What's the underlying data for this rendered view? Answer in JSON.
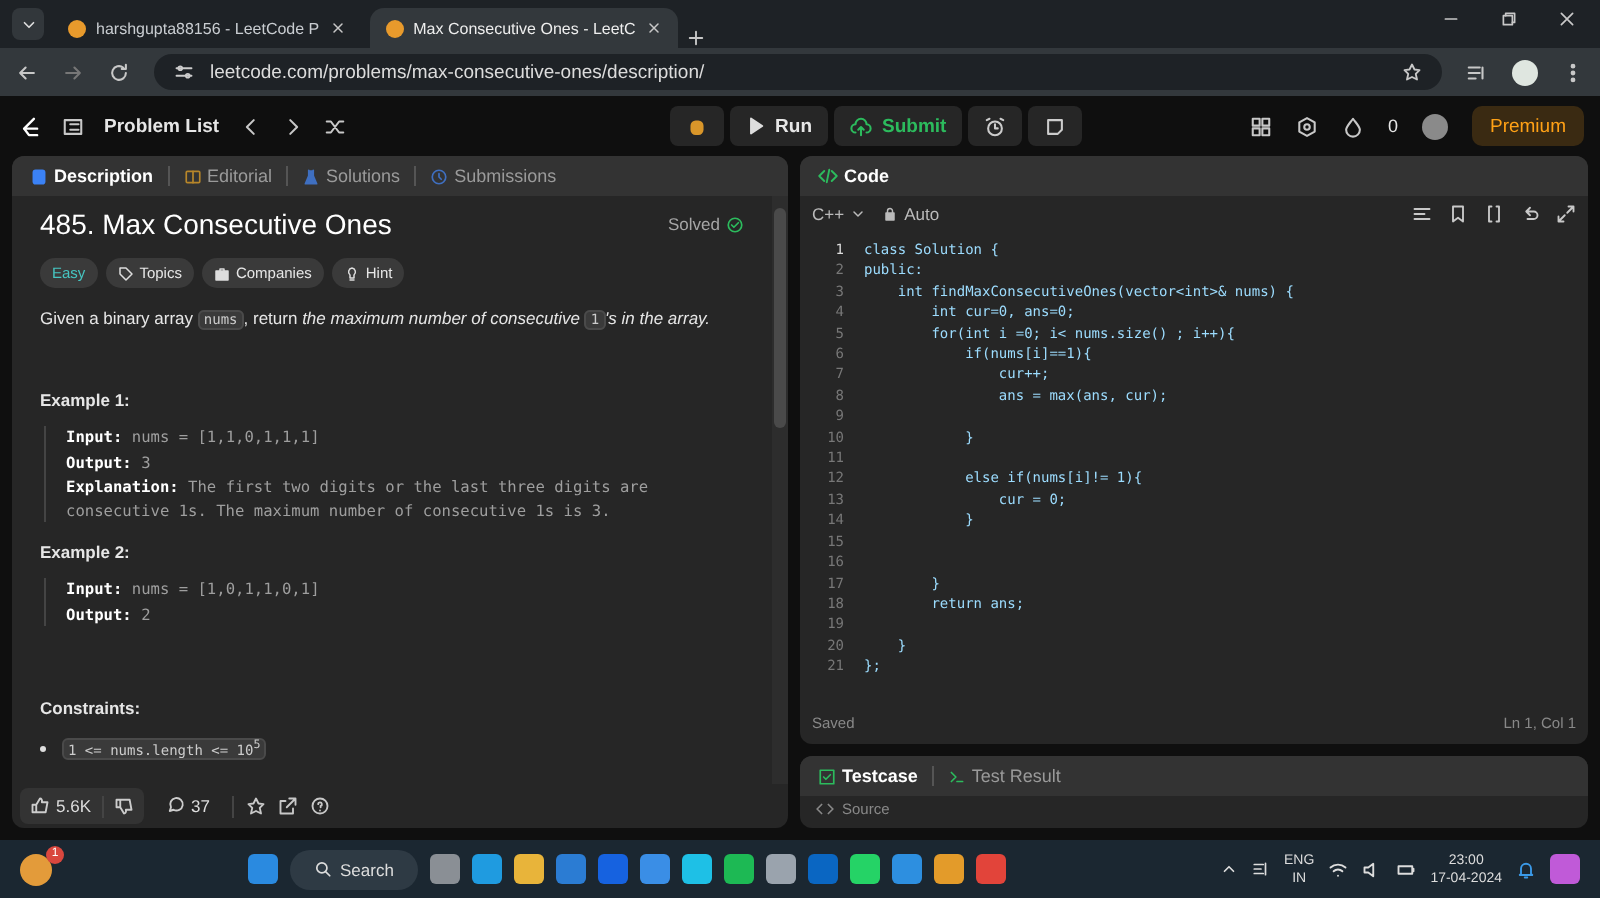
{
  "browser": {
    "tabs": [
      {
        "title": "harshgupta88156 - LeetCode P",
        "selected": false
      },
      {
        "title": "Max Consecutive Ones - LeetC",
        "selected": true
      }
    ],
    "url": "leetcode.com/problems/max-consecutive-ones/description/"
  },
  "navbar": {
    "problem_list": "Problem List",
    "run": "Run",
    "submit": "Submit",
    "streak": "0",
    "premium": "Premium"
  },
  "description_panel": {
    "tabs": [
      {
        "label": "Description",
        "selected": true
      },
      {
        "label": "Editorial",
        "selected": false
      },
      {
        "label": "Solutions",
        "selected": false
      },
      {
        "label": "Submissions",
        "selected": false
      }
    ],
    "title": "485. Max Consecutive Ones",
    "status": "Solved",
    "tags": [
      {
        "label": "Easy",
        "kind": "difficulty"
      },
      {
        "label": "Topics",
        "kind": "topics"
      },
      {
        "label": "Companies",
        "kind": "companies"
      },
      {
        "label": "Hint",
        "kind": "hint"
      }
    ],
    "statement": [
      {
        "kind": "text",
        "text": "Given a binary array "
      },
      {
        "kind": "code",
        "text": "nums"
      },
      {
        "kind": "text",
        "text": ", return "
      },
      {
        "kind": "italic",
        "text": "the maximum number of consecutive "
      },
      {
        "kind": "code",
        "text": "1"
      },
      {
        "kind": "italic",
        "text": "'s in the array."
      }
    ],
    "examples": [
      {
        "heading": "Example 1:",
        "lines": [
          {
            "label": "Input:",
            "value": "nums = [1,1,0,1,1,1]"
          },
          {
            "label": "Output:",
            "value": "3"
          },
          {
            "label": "Explanation:",
            "value": "The first two digits or the last three digits are consecutive 1s. The maximum number of consecutive 1s is 3."
          }
        ]
      },
      {
        "heading": "Example 2:",
        "lines": [
          {
            "label": "Input:",
            "value": "nums = [1,0,1,1,0,1]"
          },
          {
            "label": "Output:",
            "value": "2"
          }
        ]
      }
    ],
    "constraints_heading": "Constraints:",
    "constraints": [
      "1 <= nums.length <= 10$^{5}$"
    ],
    "footer": {
      "likes": "5.6K",
      "comments": "37"
    }
  },
  "code_panel": {
    "title": "Code",
    "language": "C++",
    "mode": "Auto",
    "lines": [
      {
        "number": "1",
        "text": "class Solution {"
      },
      {
        "number": "2",
        "text": "public:"
      },
      {
        "number": "3",
        "text": "    int findMaxConsecutiveOnes(vector<int>& nums) {"
      },
      {
        "number": "4",
        "text": "        int cur=0, ans=0;"
      },
      {
        "number": "5",
        "text": "        for(int i =0; i< nums.size() ; i++){"
      },
      {
        "number": "6",
        "text": "            if(nums[i]==1){"
      },
      {
        "number": "7",
        "text": "                cur++;"
      },
      {
        "number": "8",
        "text": "                ans = max(ans, cur);"
      },
      {
        "number": "9"
      },
      {
        "number": "10",
        "text": "            }"
      },
      {
        "number": "11"
      },
      {
        "number": "12",
        "text": "            else if(nums[i]!= 1){"
      },
      {
        "number": "13",
        "text": "                cur = 0;"
      },
      {
        "number": "14",
        "text": "            }"
      },
      {
        "number": "15"
      },
      {
        "number": "16"
      },
      {
        "number": "17",
        "text": "        }"
      },
      {
        "number": "18",
        "text": "        return ans;"
      },
      {
        "number": "19"
      },
      {
        "number": "20",
        "text": "    }"
      },
      {
        "number": "21",
        "text": "};"
      }
    ],
    "saved": "Saved",
    "cursor": "Ln 1, Col 1",
    "bottom_tabs": [
      {
        "label": "Testcase",
        "selected": true
      },
      {
        "label": "Test Result",
        "selected": false
      }
    ],
    "source": "Source"
  },
  "taskbar": {
    "notification_count": "1",
    "search": "Search",
    "language": "ENG",
    "region": "IN",
    "time": "23:00",
    "date": "17-04-2024"
  }
}
